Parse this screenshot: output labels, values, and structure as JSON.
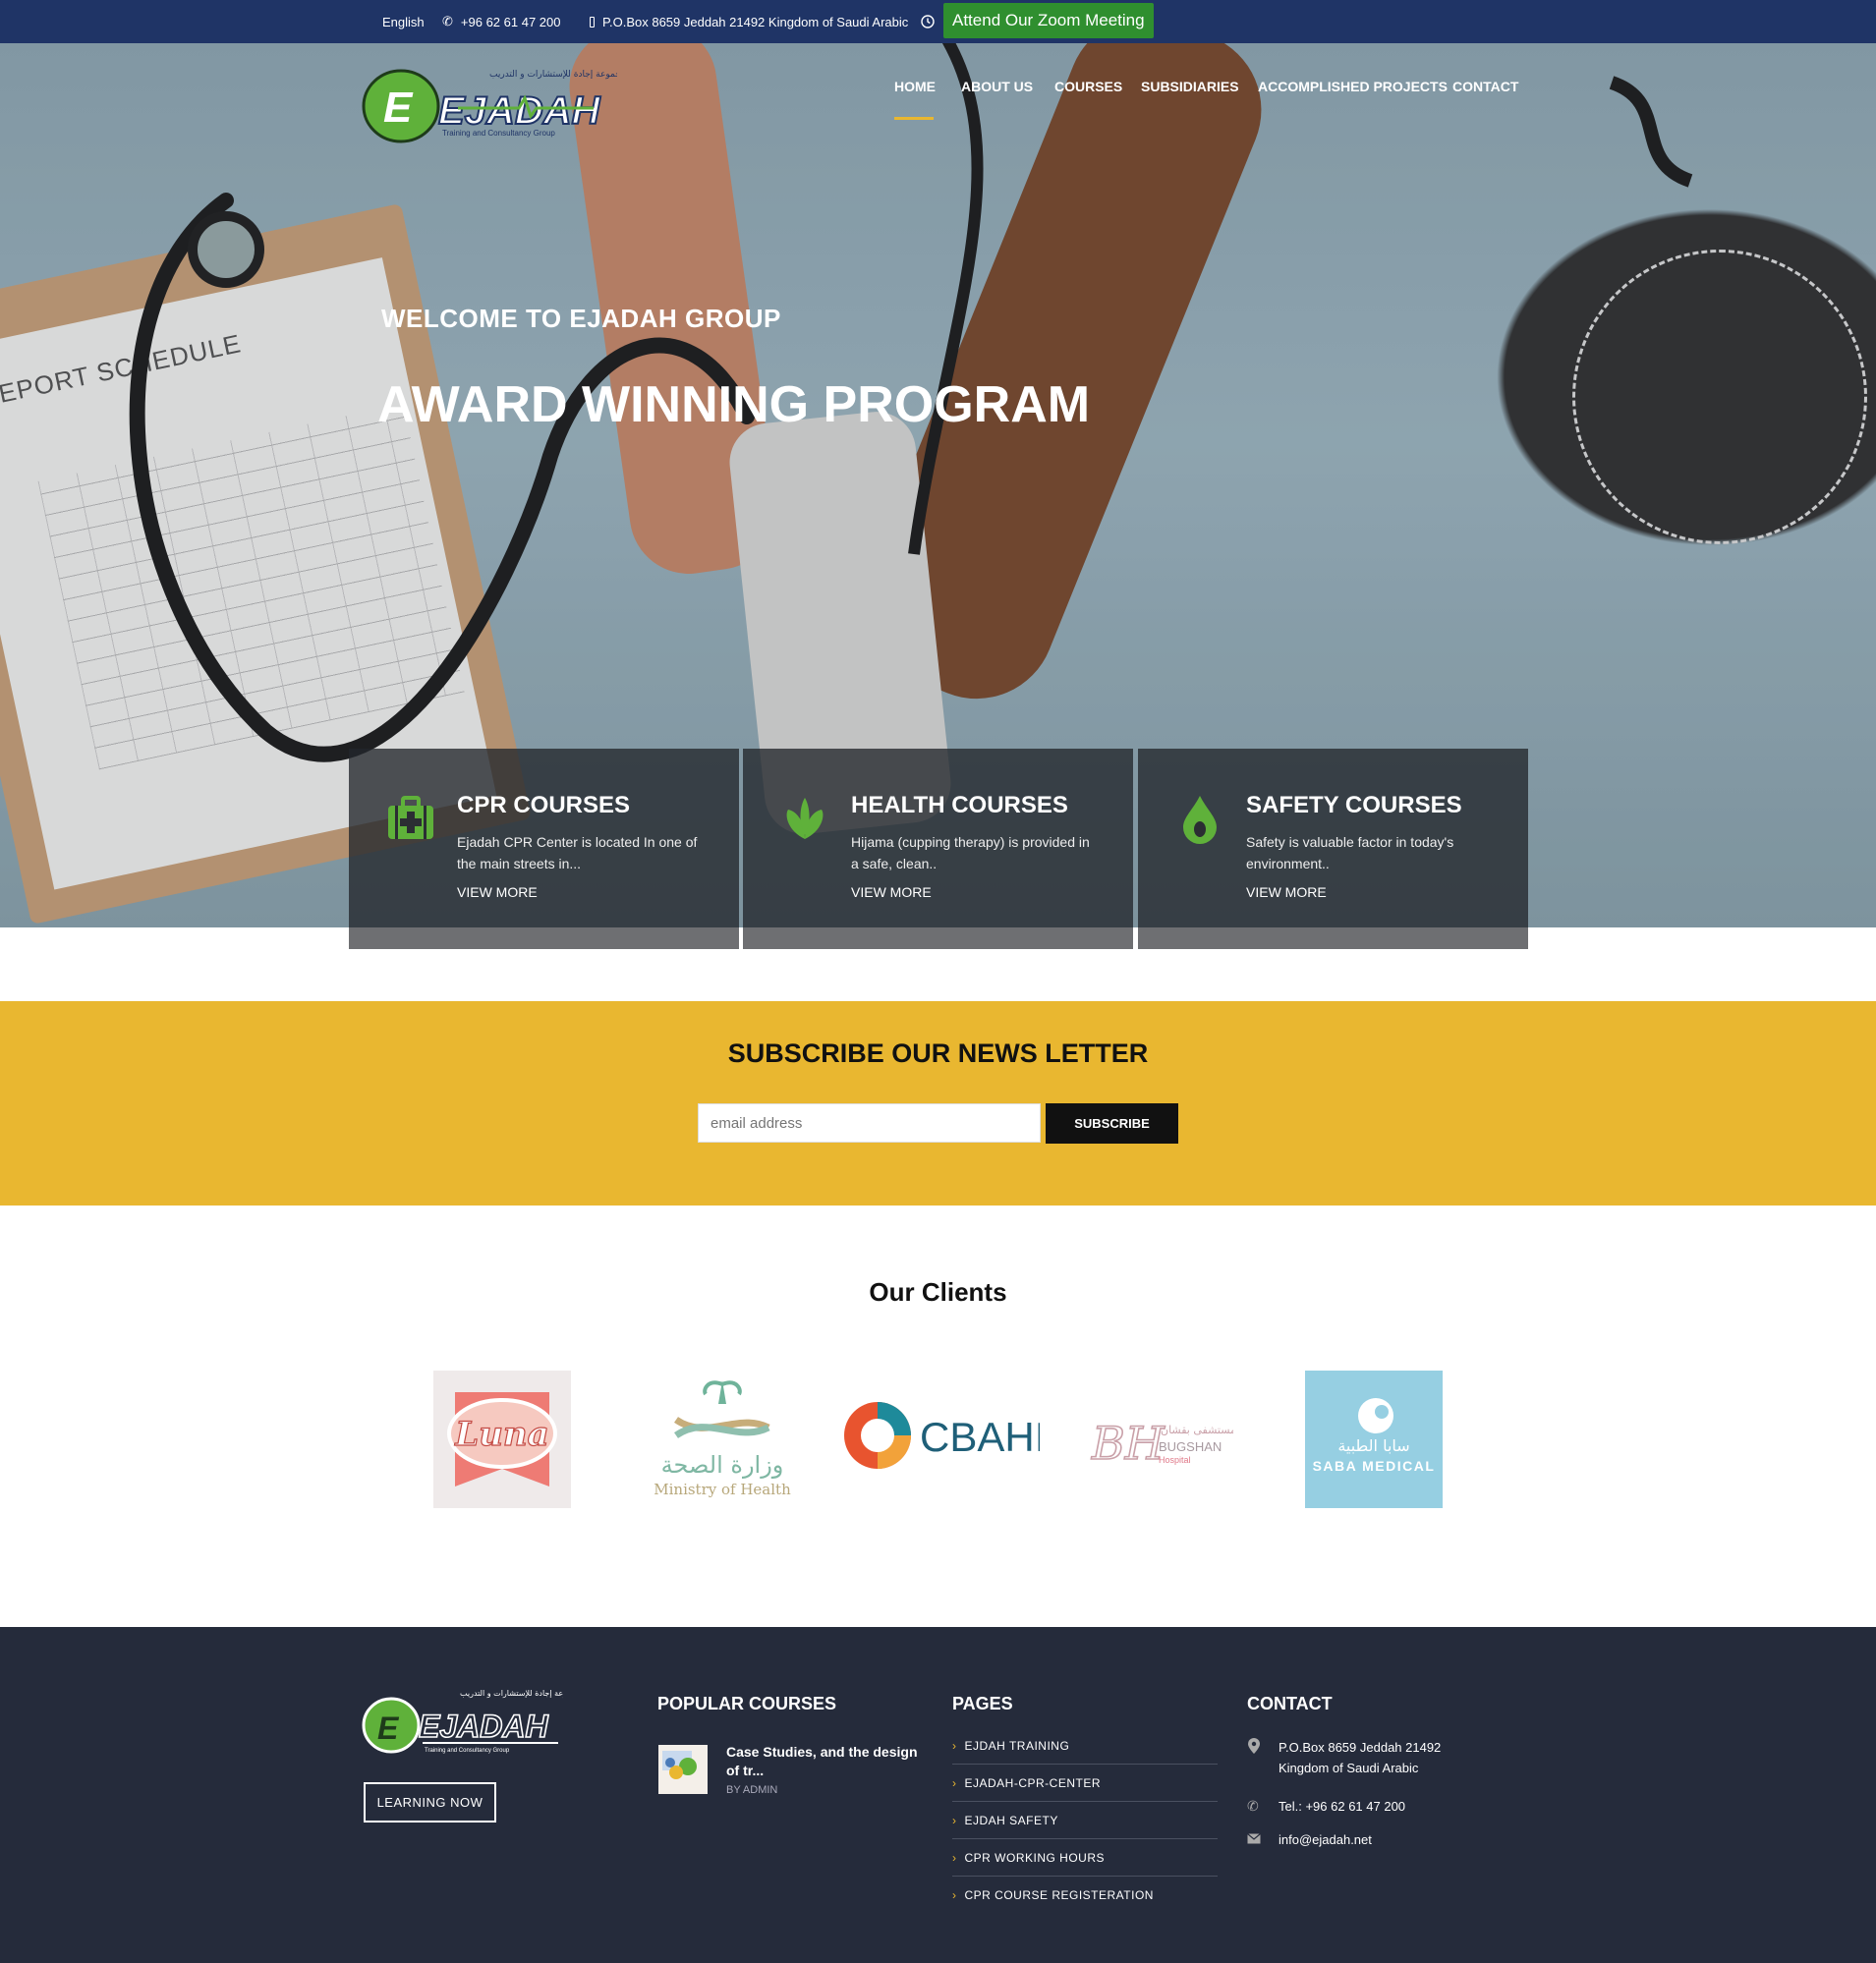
{
  "topbar": {
    "language": "English",
    "phone": "+96 62 61 47 200",
    "address": "P.O.Box 8659 Jeddah 21492 Kingdom of Saudi Arabic",
    "zoom_label": "Attend Our Zoom Meeting"
  },
  "logo": {
    "name": "EJADAH",
    "arabic": "مجموعة إجادة للإستشارات و التدريب",
    "tagline": "Training and Consultancy Group"
  },
  "nav": [
    "HOME",
    "ABOUT US",
    "COURSES",
    "SUBSIDIARIES",
    "ACCOMPLISHED PROJECTS",
    "CONTACT"
  ],
  "hero": {
    "subtitle": "WELCOME TO EJADAH GROUP",
    "title": "AWARD WINNING PROGRAM",
    "clipboard_text": "REPORT SCHEDULE"
  },
  "courses": [
    {
      "title": "CPR COURSES",
      "text": "Ejadah CPR Center is located In one of the main streets in...",
      "more": "VIEW MORE",
      "icon": "first-aid-kit-icon"
    },
    {
      "title": "HEALTH COURSES",
      "text": "Hijama (cupping therapy) is provided in a safe, clean..",
      "more": "VIEW MORE",
      "icon": "leaf-icon"
    },
    {
      "title": "SAFETY COURSES",
      "text": "Safety is valuable factor in today's environment..",
      "more": "VIEW MORE",
      "icon": "drop-icon"
    }
  ],
  "subscribe": {
    "title": "SUBSCRIBE OUR NEWS LETTER",
    "placeholder": "email address",
    "button": "SUBSCRIBE"
  },
  "clients": {
    "title": "Our Clients",
    "items": [
      {
        "name": "Luna"
      },
      {
        "name": "وزارة الصحة",
        "sub": "Ministry of Health"
      },
      {
        "name": "CBAHI"
      },
      {
        "name": "BH",
        "arabic": "مستشفى بقشان",
        "sub": "BUGSHAN",
        "sub2": "Hospital"
      },
      {
        "name": "SABA MEDICAL",
        "arabic": "سابا الطبية"
      }
    ]
  },
  "footer": {
    "learn_button": "LEARNING NOW",
    "popular_title": "POPULAR COURSES",
    "course": {
      "title": "Case Studies, and the design of tr...",
      "by": "BY ADMIN"
    },
    "pages_title": "PAGES",
    "pages": [
      "EJDAH TRAINING",
      "EJADAH-CPR-CENTER",
      "EJDAH SAFETY",
      "CPR WORKING HOURS",
      "CPR COURSE REGISTERATION"
    ],
    "contact_title": "CONTACT",
    "contact": {
      "address": "P.O.Box 8659 Jeddah 21492 Kingdom of Saudi Arabic",
      "phone": "Tel.: +96 62 61 47 200",
      "email": "info@ejadah.net"
    }
  },
  "colors": {
    "topbar": "#1f3466",
    "accent": "#e9b730",
    "zoom": "#2f8f2f",
    "footer": "#252b3b",
    "icon_green": "#5fb13a"
  }
}
